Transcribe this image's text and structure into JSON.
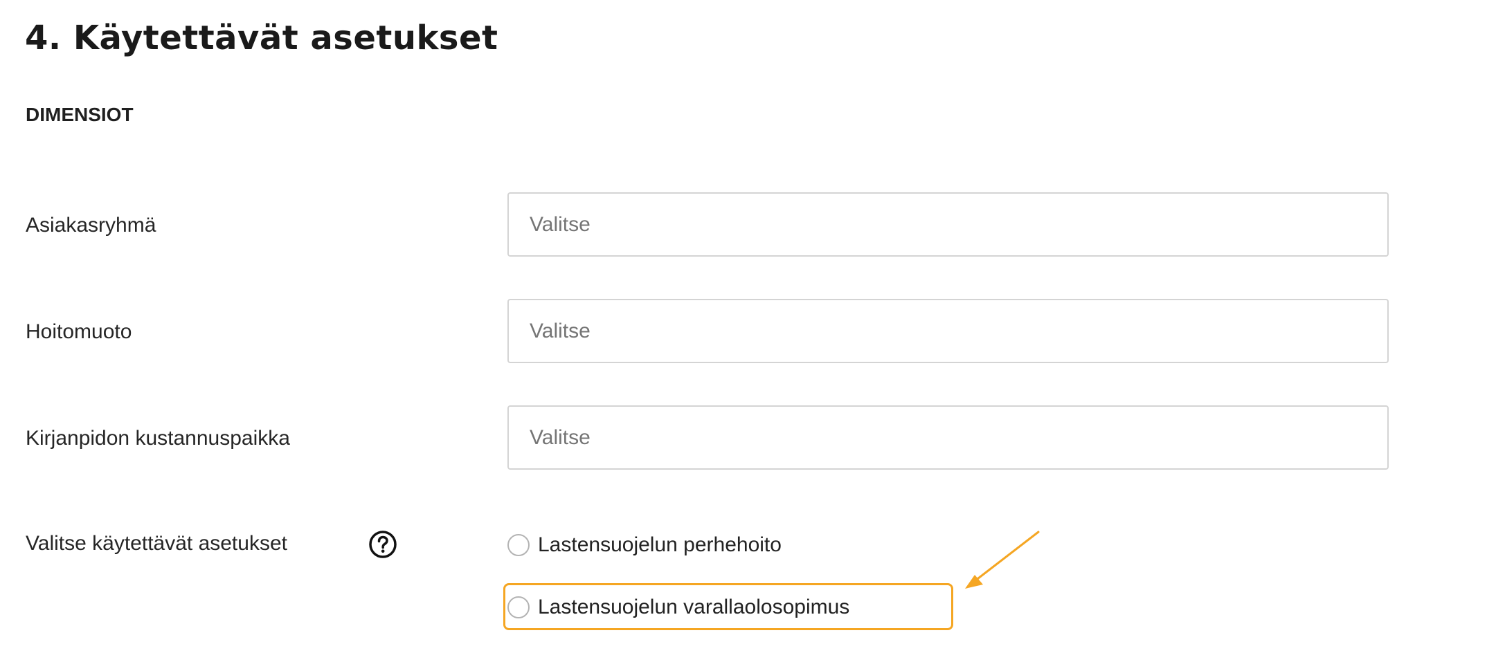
{
  "section": {
    "title": "4. Käytettävät asetukset",
    "subheading": "DIMENSIOT"
  },
  "fields": [
    {
      "label": "Asiakasryhmä",
      "placeholder": "Valitse"
    },
    {
      "label": "Hoitomuoto",
      "placeholder": "Valitse"
    },
    {
      "label": "Kirjanpidon kustannuspaikka",
      "placeholder": "Valitse"
    }
  ],
  "settings": {
    "label": "Valitse käytettävät asetukset",
    "help_icon": "question-circle-icon",
    "options": [
      {
        "label": "Lastensuojelun perhehoito",
        "selected": false
      },
      {
        "label": "Lastensuojelun varallaolosopimus",
        "selected": false
      }
    ]
  },
  "annotation": {
    "highlight_color": "#f5a623",
    "arrow_icon": "annotation-arrow-icon"
  }
}
